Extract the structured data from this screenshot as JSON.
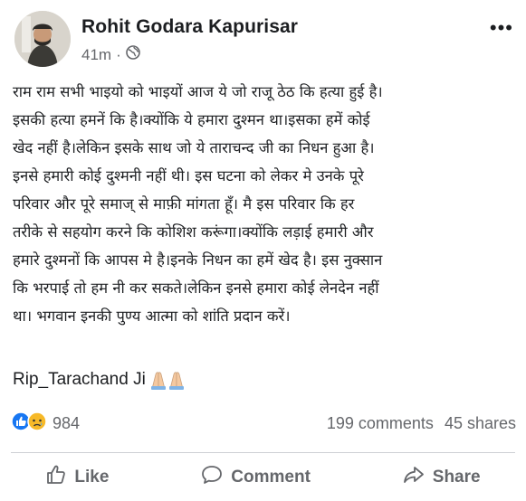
{
  "post": {
    "author": "Rohit Godara Kapurisar",
    "time": "41m",
    "separator": "·",
    "audience_icon": "globe-icon",
    "more_icon": "more-options-icon",
    "more_glyph": "•••",
    "body_lines": [
      "राम राम सभी भाइयो को भाइयों आज ये जो राजू ठेठ कि हत्या हुई है।",
      "इसकी हत्या हमनें कि है।क्योंकि ये हमारा दुश्मन था।इसका हमें कोई",
      "खेद नहीं है।लेकिन इसके साथ जो ये ताराचन्द जी का निधन हुआ है।",
      "इनसे हमारी कोई दुश्मनी नहीं थी। इस घटना को लेकर मे उनके पूरे",
      "परिवार और पूरे समाज् से माफ़ी मांगता हूँ। मै इस परिवार कि हर",
      "तरीके से सहयोग करने कि कोशिश करूंगा।क्योंकि लड़ाई हमारी और",
      "हमारे दुश्मनों कि आपस मे है।इनके निधन का हमें खेद है। इस नुक्सान",
      "कि भरपाई तो हम नी कर सकते।लेकिन इनसे हमारा कोई लेनदेन नहीं",
      "था। भगवान इनकी पुण्य आत्मा को शांति प्रदान करें।"
    ],
    "rip_text": "Rip_Tarachand Ji",
    "rip_emoji": "folded-hands-icon"
  },
  "stats": {
    "reaction_icons": [
      "like-reaction-icon",
      "sad-reaction-icon"
    ],
    "reaction_count": "984",
    "comments": "199 comments",
    "shares": "45 shares"
  },
  "actions": {
    "like": "Like",
    "comment": "Comment",
    "share": "Share"
  },
  "colors": {
    "text": "#1c1e21",
    "secondary": "#65676b",
    "like_blue": "#1877f2",
    "sad_yellow": "#f7b928",
    "divider": "#ced0d4"
  }
}
